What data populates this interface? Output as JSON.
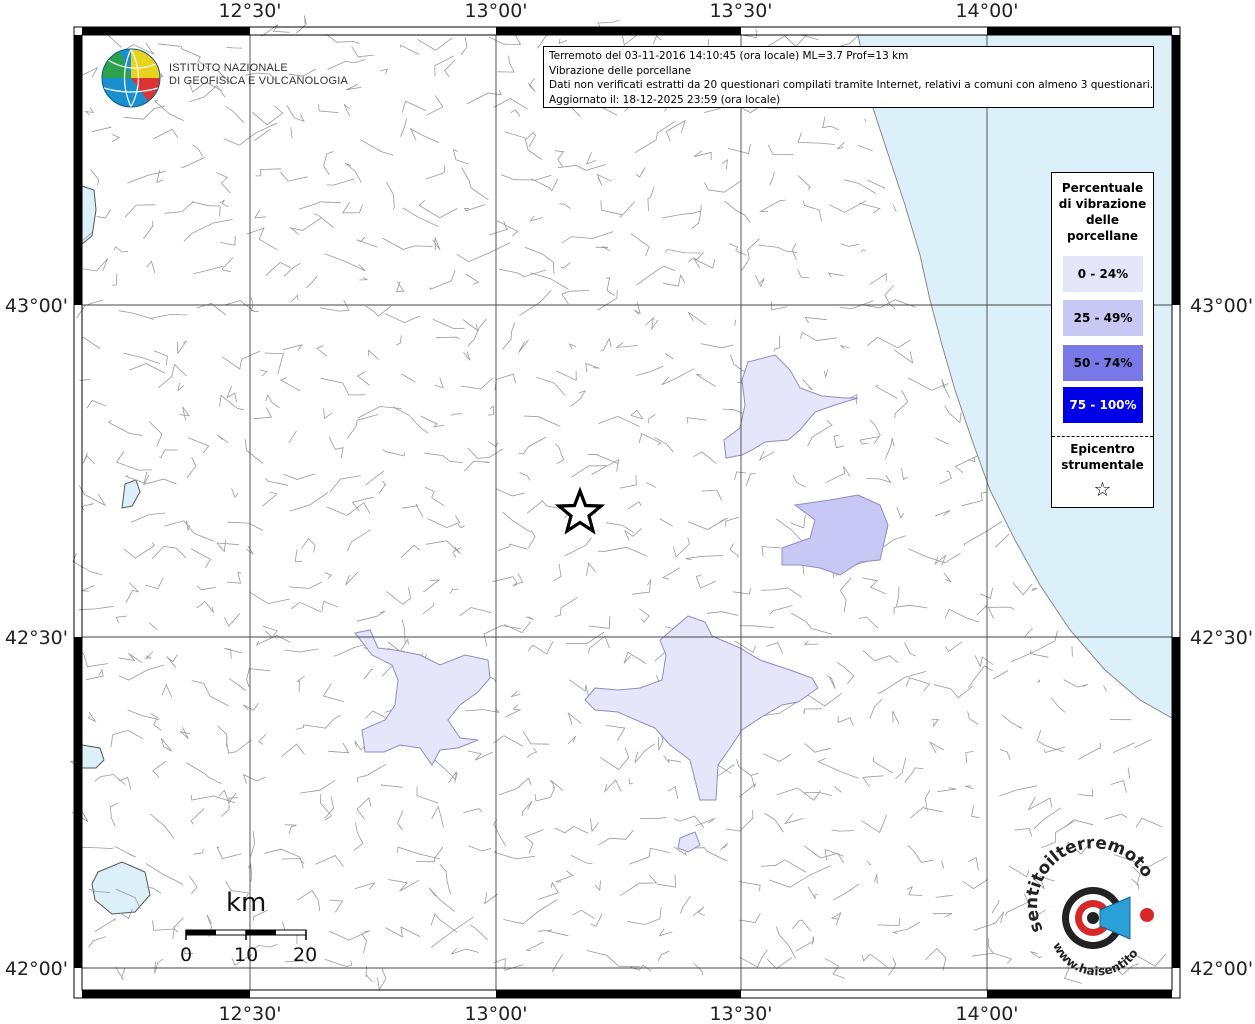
{
  "header": {
    "title_line1": "Terremoto del 03-11-2016 14:10:45 (ora locale) ML=3.7 Prof=13 km",
    "title_line2": "Vibrazione delle porcellane",
    "title_line3": "Dati non verificati estratti da 20 questionari compilati tramite Internet, relativi a comuni con almeno 3 questionari.",
    "title_line4": "Aggiornato il: 18-12-2025 23:59 (ora locale)"
  },
  "logo": {
    "line1": "ISTITUTO NAZIONALE",
    "line2": "DI GEOFISICA E VULCANOLOGIA"
  },
  "axes": {
    "top_labels": [
      "12°30'",
      "13°00'",
      "13°30'",
      "14°00'"
    ],
    "bottom_labels": [
      "12°30'",
      "13°00'",
      "13°30'",
      "14°00'"
    ],
    "left_labels": [
      "43°00'",
      "42°30'",
      "42°00'"
    ],
    "right_labels": [
      "43°00'",
      "42°30'",
      "42°00'"
    ]
  },
  "legend": {
    "title": "Percentuale di vibrazione delle porcellane",
    "items": [
      {
        "label": "0 - 24%",
        "color": "#e6e6fa",
        "text_color": "#000000"
      },
      {
        "label": "25 - 49%",
        "color": "#c8c8f5",
        "text_color": "#000000"
      },
      {
        "label": "50 - 74%",
        "color": "#7878e6",
        "text_color": "#000000"
      },
      {
        "label": "75 - 100%",
        "color": "#0000e6",
        "text_color": "#ffffff"
      }
    ],
    "epicenter_label": "Epicentro strumentale",
    "epicenter_symbol": "☆"
  },
  "scale_bar": {
    "unit": "km",
    "ticks": [
      "0",
      "10",
      "20"
    ]
  },
  "badge": {
    "text_top": "sentitoilterremoto.it",
    "text_bottom": "www.haisentito",
    "icon": "megaphone-icon"
  },
  "colors": {
    "sea": "#dcf0fa",
    "borders": "#9a9a9a",
    "class_0_24": "#e6e6fa",
    "class_25_49": "#c8c8f5"
  }
}
